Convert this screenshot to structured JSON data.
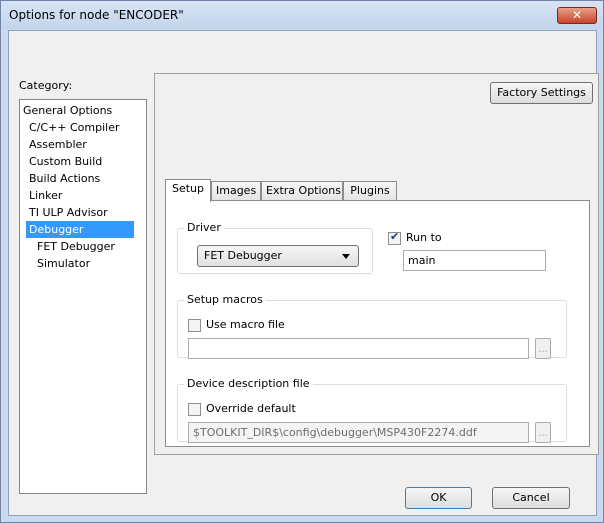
{
  "window": {
    "title": "Options for node \"ENCODER\"",
    "close_glyph": "✕"
  },
  "category": {
    "label": "Category:",
    "items": [
      {
        "label": "General Options"
      },
      {
        "label": "C/C++ Compiler"
      },
      {
        "label": "Assembler"
      },
      {
        "label": "Custom Build"
      },
      {
        "label": "Build Actions"
      },
      {
        "label": "Linker"
      },
      {
        "label": "TI ULP Advisor"
      },
      {
        "label": "Debugger"
      },
      {
        "label": "FET Debugger"
      },
      {
        "label": "Simulator"
      }
    ],
    "selected": "Debugger"
  },
  "factory_settings_label": "Factory Settings",
  "tabs": [
    {
      "label": "Setup"
    },
    {
      "label": "Images"
    },
    {
      "label": "Extra Options"
    },
    {
      "label": "Plugins"
    }
  ],
  "setup": {
    "driver": {
      "caption": "Driver",
      "value": "FET Debugger"
    },
    "run_to": {
      "label": "Run to",
      "checked": true,
      "value": "main"
    },
    "setup_macros": {
      "caption": "Setup macros",
      "checkbox_label": "Use macro file",
      "checked": false,
      "value": "",
      "browse_label": "..."
    },
    "device_description": {
      "caption": "Device description file",
      "checkbox_label": "Override default",
      "checked": false,
      "value": "$TOOLKIT_DIR$\\config\\debugger\\MSP430F2274.ddf",
      "browse_label": "..."
    }
  },
  "buttons": {
    "ok": "OK",
    "cancel": "Cancel"
  }
}
